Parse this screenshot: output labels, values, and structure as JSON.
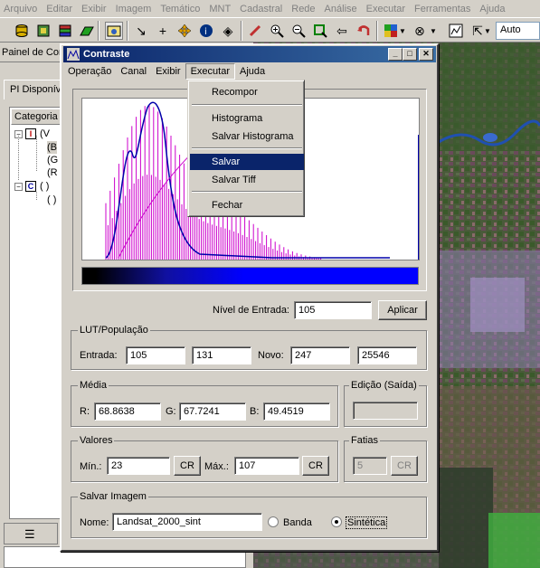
{
  "main_menu": [
    "Arquivo",
    "Editar",
    "Exibir",
    "Imagem",
    "Temático",
    "MNT",
    "Cadastral",
    "Rede",
    "Análise",
    "Executar",
    "Ferramentas",
    "Ajuda"
  ],
  "toolbar": {
    "zoom_mode": "Auto"
  },
  "left_panel": {
    "title": "Painel de Con",
    "tab": "PI Disponív",
    "column_header": "Categoria",
    "tree": [
      {
        "text": "(V",
        "icon": "I"
      },
      {
        "text": "(B"
      },
      {
        "text": "(G"
      },
      {
        "text": "(R"
      },
      {
        "text": "( )",
        "icon": "C"
      },
      {
        "text": "( )"
      }
    ]
  },
  "dialog": {
    "title": "Contraste",
    "menu": [
      "Operação",
      "Canal",
      "Exibir",
      "Executar",
      "Ajuda"
    ],
    "active_menu": "Executar",
    "dropdown": {
      "items": [
        "Recompor",
        "Histograma",
        "Salvar Histograma",
        "Salvar",
        "Salvar Tiff",
        "Fechar"
      ],
      "selected": "Salvar"
    },
    "input_level": {
      "label": "Nível de Entrada:",
      "value": "105",
      "apply": "Aplicar"
    },
    "lut": {
      "title": "LUT/População",
      "entrada_label": "Entrada:",
      "entrada_1": "105",
      "entrada_2": "131",
      "novo_label": "Novo:",
      "novo_1": "247",
      "novo_2": "25546"
    },
    "media": {
      "title": "Média",
      "r_label": "R:",
      "r": "68.8638",
      "g_label": "G:",
      "g": "67.7241",
      "b_label": "B:",
      "b": "49.4519"
    },
    "edicao": {
      "title": "Edição (Saída)",
      "value": ""
    },
    "valores": {
      "title": "Valores",
      "min_label": "Mín.:",
      "min": "23",
      "cr1": "CR",
      "max_label": "Máx.:",
      "max": "107",
      "cr2": "CR"
    },
    "fatias": {
      "title": "Fatias",
      "value": "5",
      "cr": "CR"
    },
    "salvar": {
      "title": "Salvar Imagem",
      "nome_label": "Nome:",
      "nome": "Landsat_2000_sint",
      "banda": "Banda",
      "sintetica": "Sintética",
      "selected": "Sintética"
    }
  },
  "colors": {
    "titlebar": "#0a246a",
    "histogram": "#cc00cc",
    "curve": "#0000aa",
    "face": "#d4d0c8"
  }
}
